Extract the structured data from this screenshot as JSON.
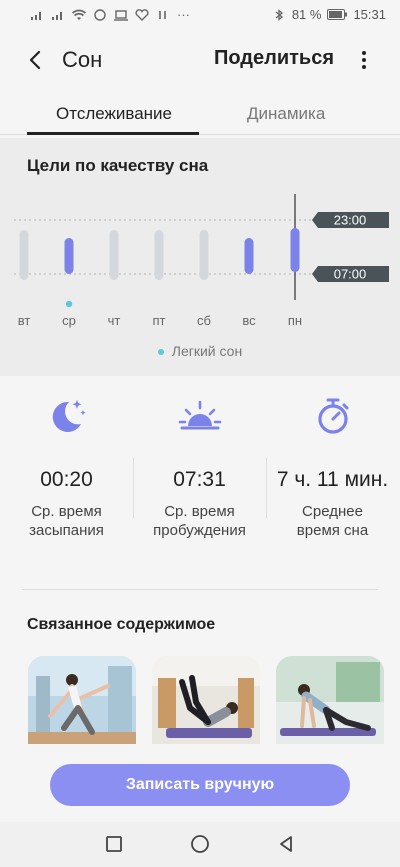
{
  "status_bar": {
    "battery": "81 %",
    "time": "15:31"
  },
  "app_bar": {
    "title": "Сон",
    "share_label": "Поделиться"
  },
  "tabs": [
    {
      "label": "Отслеживание",
      "active": true
    },
    {
      "label": "Динамика",
      "active": false
    }
  ],
  "sleep_goals": {
    "title": "Цели по качеству сна",
    "bedtime_label": "23:00",
    "wake_label": "07:00",
    "legend": "Легкий сон"
  },
  "chart_data": {
    "type": "bar",
    "categories": [
      "вт",
      "ср",
      "чт",
      "пт",
      "сб",
      "вс",
      "пн"
    ],
    "series": [
      {
        "values": [
          0,
          1,
          0,
          0,
          0,
          1,
          1
        ]
      }
    ],
    "markers": [
      "",
      "light",
      "",
      "",
      "",
      "",
      ""
    ],
    "selected": "пн",
    "colors": {
      "met": "#7b83ea",
      "unmet": "#d4d7db",
      "light_sleep": "#5bc8e0"
    }
  },
  "stats": [
    {
      "icon": "moon-stars-icon",
      "value": "00:20",
      "label_1": "Ср. время",
      "label_2": "засыпания"
    },
    {
      "icon": "sunrise-icon",
      "value": "07:31",
      "label_1": "Ср. время",
      "label_2": "пробуждения"
    },
    {
      "icon": "stopwatch-icon",
      "value": "7 ч. 11 мин.",
      "label_1": "Среднее",
      "label_2": "время сна"
    }
  ],
  "related": {
    "title": "Связанное содержимое"
  },
  "actions": {
    "record_manual": "Записать вручную"
  },
  "accent": "#7b83ea"
}
